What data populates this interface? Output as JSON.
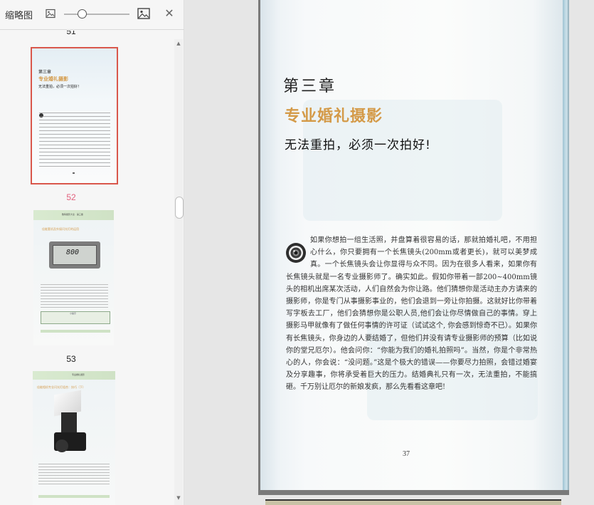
{
  "thumbnail_panel": {
    "title": "缩略图",
    "icons": {
      "small_image": "image-icon-small",
      "large_image": "image-icon-large",
      "close": "close-icon"
    },
    "close_glyph": "✕",
    "scroll_up_glyph": "▲",
    "scroll_down_glyph": "▼",
    "zoom_level": 0.22,
    "pages": [
      {
        "number": "51",
        "state": "partial"
      },
      {
        "number": "52",
        "state": "selected"
      },
      {
        "number": "53",
        "state": "normal"
      }
    ],
    "thumb52": {
      "chapter": "第三章",
      "title": "专业婚礼摄影",
      "subtitle": "无法重拍，必须一次拍好！"
    },
    "thumb53": {
      "header": "数码摄影大全 · 第三章",
      "section": "佳能套机及外接闪光灯的运用",
      "display": "800",
      "box_label": "小提示"
    },
    "thumb54": {
      "header": "专业婚礼摄影",
      "section": "佳能相机专业闪光灯组合：技巧（下）"
    }
  },
  "document": {
    "chapter_label": "第三章",
    "chapter_title": "专业婚礼摄影",
    "chapter_subtitle": "无法重拍，必须一次拍好!",
    "body": "如果你想拍一组生活照，并盘算着很容易的话，那就拍婚礼吧，不用担心什么，你只要拥有一个长焦镜头(200mm或者更长)，就可以美梦成真。一个长焦镜头会让你显得与众不同。因为在很多人看来，如果你有长焦镜头就是一名专业摄影师了。确实如此。假如你带着一部200~400mm镜头的相机出席某次活动，人们自然会为你让路。他们猜想你是活动主办方请来的摄影师，你是专门从事摄影事业的，他们会退到一旁让你拍摄。这就好比你带着写字板去工厂，他们会猜想你是公职人员,他们会让你尽情做自己的事情。穿上摄影马甲就像有了做任何事情的许可证（试试这个, 你会感到惊奇不已）。如果你有长焦镜头，你身边的人要结婚了，但他们并没有请专业摄影师的预算（比如说你的堂兄厄尔）。他会问你：“你能为我们的婚礼拍照吗”。当然，你是个非常热心的人，你会说：“没问题。”这是个极大的错误——你要尽力拍照，会错过婚宴及分享趣事，你将承受着巨大的压力。结婚典礼只有一次，无法重拍，不能搞砸。千万别让厄尔的新娘发疯，那么先看看这章吧!",
    "page_number": "37",
    "icons": {
      "lens": "lens-icon"
    },
    "colors": {
      "title_accent": "#d49a48"
    }
  }
}
